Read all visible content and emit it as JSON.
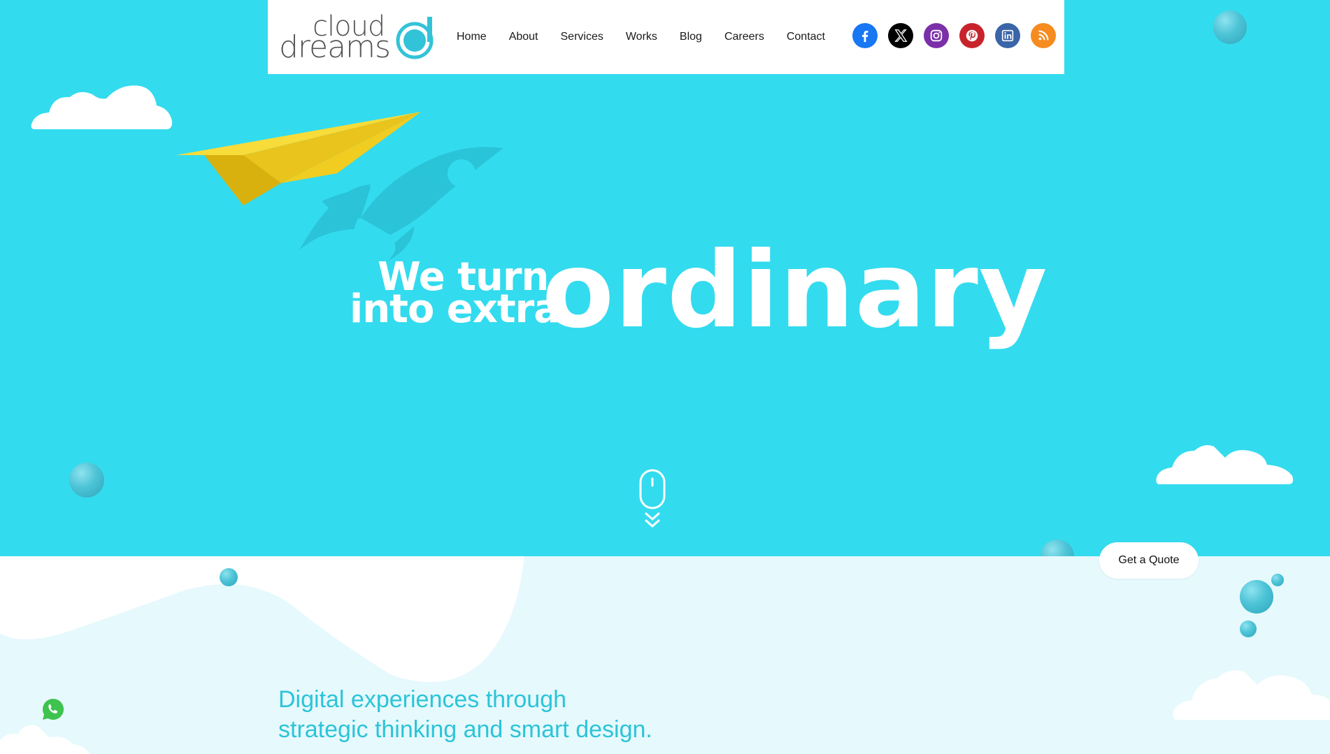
{
  "brand": {
    "logo_line1": "cloud",
    "logo_line2": "dreams"
  },
  "nav": {
    "items": [
      "Home",
      "About",
      "Services",
      "Works",
      "Blog",
      "Careers",
      "Contact"
    ]
  },
  "social": [
    {
      "icon": "facebook-icon",
      "color": "#1877f2"
    },
    {
      "icon": "x-icon",
      "color": "#000000"
    },
    {
      "icon": "instagram-icon",
      "color": "#7b2fa8"
    },
    {
      "icon": "pinterest-icon",
      "color": "#c8232c"
    },
    {
      "icon": "linkedin-icon",
      "color": "#3a65a8"
    },
    {
      "icon": "rss-icon",
      "color": "#f68b1f"
    }
  ],
  "hero": {
    "line1": "We turn",
    "line2": "into extra",
    "big_word": "ordinary",
    "background": "#33dbee"
  },
  "cta": {
    "quote_label": "Get a Quote"
  },
  "tagline": {
    "line1": "Digital experiences through",
    "line2": "strategic thinking and smart design.",
    "color": "#2cc4d8"
  },
  "colors": {
    "lower_bg": "#e6f9fd",
    "paper_plane": "#f2cf22",
    "rocket": "#29bfd3"
  }
}
